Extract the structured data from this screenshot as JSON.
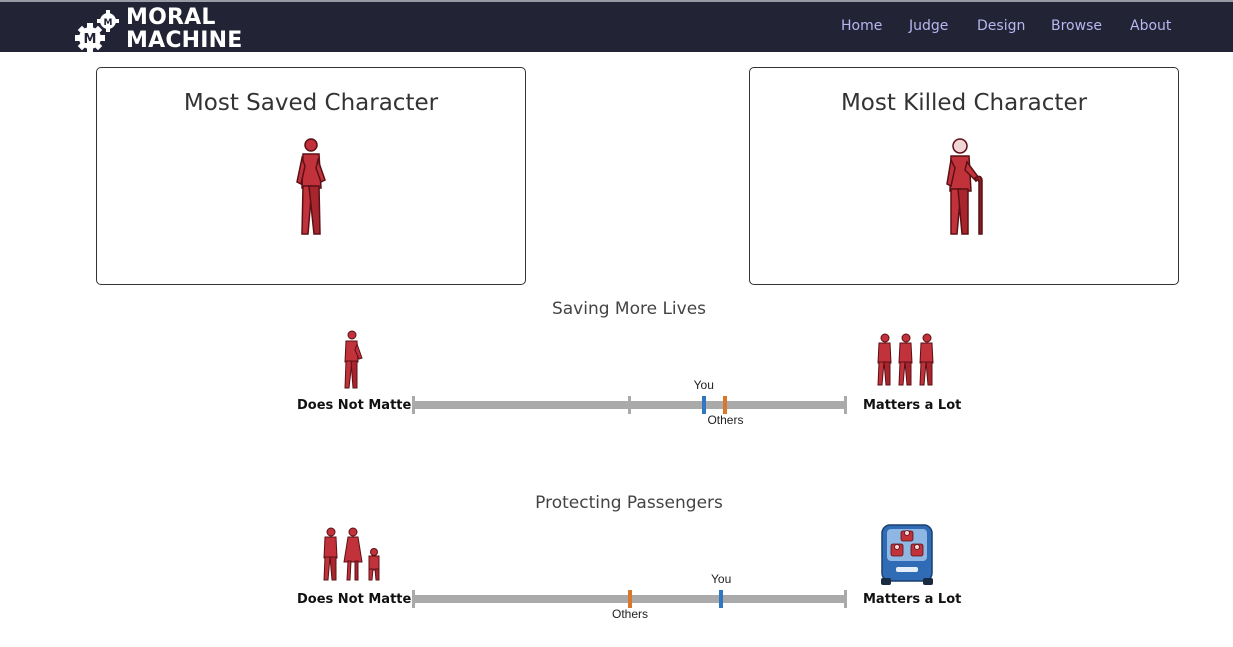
{
  "header": {
    "logo_line1": "MORAL",
    "logo_line2": "MACHINE",
    "nav": [
      "Home",
      "Judge",
      "Design",
      "Browse",
      "About"
    ]
  },
  "cards": {
    "saved": {
      "title": "Most Saved Character"
    },
    "killed": {
      "title": "Most Killed Character"
    }
  },
  "scales": [
    {
      "title": "Saving More Lives",
      "left_label": "Does Not Matter",
      "right_label": "Matters a Lot",
      "you_label": "You",
      "others_label": "Others",
      "you_value": 0.67,
      "others_value": 0.72
    },
    {
      "title": "Protecting Passengers",
      "left_label": "Does Not Matter",
      "right_label": "Matters a Lot",
      "you_label": "You",
      "others_label": "Others",
      "you_value": 0.71,
      "others_value": 0.5
    }
  ],
  "colors": {
    "nav_bg": "#222436",
    "nav_link": "#b7b6ef",
    "figure_red": "#c1323b",
    "you": "#2f77c2",
    "others": "#d9782d",
    "bar": "#aaaaaa"
  }
}
